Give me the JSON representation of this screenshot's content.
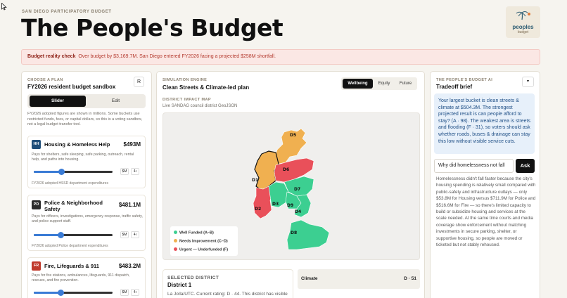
{
  "header": {
    "kicker": "SAN DIEGO PARTICIPATORY BUDGET",
    "title": "The People's Budget",
    "logo_word": "peoples",
    "logo_sub": "budget"
  },
  "alert": {
    "label": "Budget reality check",
    "message": "Over budget by $3,169.7M. San Diego entered FY2026 facing a projected $258M shortfall."
  },
  "plan": {
    "caption": "CHOOSE A PLAN",
    "title": "FY2026 resident budget sandbox",
    "reset_label": "R",
    "modes": [
      "Slider",
      "Edit"
    ],
    "active_mode": "Slider",
    "note": "FY2026 adopted figures are shown in millions. Some buckets use restricted funds, fees, or capital dollars, so this is a voting sandbox, not a legal budget transfer tool.",
    "unit_label": "$M",
    "unit_alt": "4ı",
    "cards": [
      {
        "badge": "HH",
        "badge_color": "#1f4e79",
        "name": "Housing & Homeless Help",
        "amount": "$493M",
        "desc": "Pays for shelters, safe sleeping, safe parking, outreach, rental help, and paths into housing.",
        "level": 0.35,
        "source": "FY2026 adopted HSSD department expenditures"
      },
      {
        "badge": "PD",
        "badge_color": "#2b2b2b",
        "name": "Police & Neighborhood Safety",
        "amount": "$481.1M",
        "desc": "Pays for officers, investigations, emergency response, traffic safety, and police support staff.",
        "level": 0.34,
        "source": "FY2026 adopted Police department expenditures"
      },
      {
        "badge": "FR",
        "badge_color": "#c0392b",
        "name": "Fire, Lifeguards & 911",
        "amount": "$483.2M",
        "desc": "Pays for fire stations, ambulances, lifeguards, 911 dispatch, rescues, and fire prevention.",
        "level": 0.34,
        "source": ""
      }
    ]
  },
  "simulation": {
    "caption": "SIMULATION ENGINE",
    "title": "Clean Streets & Climate-led plan",
    "lenses": [
      "Wellbeing",
      "Equity",
      "Future"
    ],
    "active_lens": "Wellbeing",
    "map_caption": "DISTRICT IMPACT MAP",
    "map_source": "Live SANDAG council district GeoJSON",
    "districts": [
      "D1",
      "D2",
      "D3",
      "D4",
      "D5",
      "D6",
      "D7",
      "D8"
    ],
    "legend": [
      {
        "label": "Well Funded (A–B)",
        "color": "#3ccf91"
      },
      {
        "label": "Needs Improvement (C–D)",
        "color": "#f0b050"
      },
      {
        "label": "Urgent — Underfunded (F)",
        "color": "#e9505a"
      }
    ],
    "selected": {
      "caption": "SELECTED DISTRICT",
      "name": "District 1",
      "text": "La Jolla/UTC. Current rating: D · 44. This district has visible"
    },
    "metric": {
      "label": "Climate",
      "value": "D · 51"
    }
  },
  "ai": {
    "caption": "THE PEOPLE'S BUDGET AI",
    "title": "Tradeoff brief",
    "menu_glyph": "▾",
    "brief": "Your largest bucket is clean streets & climate at $504.3M. The strongest projected result is can people afford to stay? (A · 98). The weakest area is streets and flooding (F · 31), so voters should ask whether roads, buses & drainage can stay this low without visible service cuts.",
    "question_value": "Why did homelessness not fall",
    "ask_label": "Ask",
    "answer": "Homelessness didn't fall faster because the city's housing spending is relatively small compared with public-safety and infrastructure outlays — only $53.8M for Housing versus $711.9M for Police and $516.6M for Fire — so there's limited capacity to build or subsidize housing and services at the scale needed. At the same time courts and media coverage show enforcement without matching investments in secure parking, shelter, or supportive housing, so people are moved or ticketed but not stably rehoused."
  },
  "colors": {
    "green": "#3ccf91",
    "orange": "#f0b050",
    "red": "#e9505a",
    "accent": "#3a7bd5"
  }
}
